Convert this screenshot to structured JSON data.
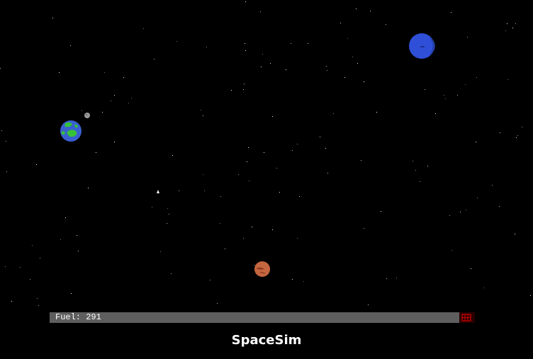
{
  "app": {
    "title": "SpaceSim"
  },
  "hud": {
    "fuel_label": "Fuel:",
    "fuel_value": "291",
    "fuel_text": "Fuel: 291"
  },
  "colors": {
    "background": "#000000",
    "fuel_bar": "#5e5e5e",
    "fuel_indicator": "#cc0000",
    "earth_ocean": "#3a5fd0",
    "earth_land": "#35c23a",
    "neptune": "#2f4fd8",
    "mars": "#c4663f",
    "moon": "#9a9a9a",
    "ship": "#ffffff"
  },
  "bodies": [
    {
      "name": "earth",
      "icon": "earth-planet-icon"
    },
    {
      "name": "moon",
      "icon": "moon-icon"
    },
    {
      "name": "neptune",
      "icon": "blue-planet-icon"
    },
    {
      "name": "mars",
      "icon": "mars-planet-icon"
    },
    {
      "name": "ship",
      "icon": "spaceship-icon"
    }
  ]
}
